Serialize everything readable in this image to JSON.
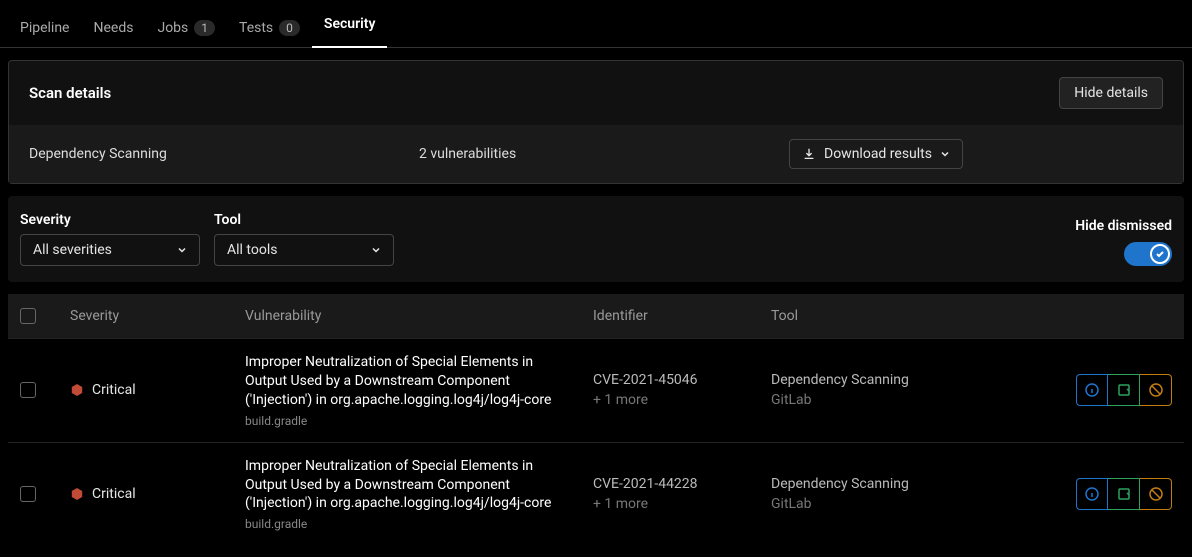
{
  "tabs": [
    {
      "label": "Pipeline",
      "badge": null,
      "active": false
    },
    {
      "label": "Needs",
      "badge": null,
      "active": false
    },
    {
      "label": "Jobs",
      "badge": "1",
      "active": false
    },
    {
      "label": "Tests",
      "badge": "0",
      "active": false
    },
    {
      "label": "Security",
      "badge": null,
      "active": true
    }
  ],
  "scan_panel": {
    "title": "Scan details",
    "hide_label": "Hide details",
    "scan_type": "Dependency Scanning",
    "vuln_count": "2 vulnerabilities",
    "download_label": "Download results"
  },
  "filters": {
    "severity_label": "Severity",
    "severity_selected": "All severities",
    "tool_label": "Tool",
    "tool_selected": "All tools",
    "hide_dismissed_label": "Hide dismissed",
    "hide_dismissed_on": true
  },
  "table": {
    "headers": {
      "severity": "Severity",
      "vulnerability": "Vulnerability",
      "identifier": "Identifier",
      "tool": "Tool"
    },
    "rows": [
      {
        "severity": "Critical",
        "title": "Improper Neutralization of Special Elements in Output Used by a Downstream Component ('Injection') in org.apache.logging.log4j/log4j-core",
        "file": "build.gradle",
        "identifier": "CVE-2021-45046",
        "id_more": "+ 1 more",
        "tool": "Dependency Scanning",
        "tool_vendor": "GitLab"
      },
      {
        "severity": "Critical",
        "title": "Improper Neutralization of Special Elements in Output Used by a Downstream Component ('Injection') in org.apache.logging.log4j/log4j-core",
        "file": "build.gradle",
        "identifier": "CVE-2021-44228",
        "id_more": "+ 1 more",
        "tool": "Dependency Scanning",
        "tool_vendor": "GitLab"
      }
    ]
  }
}
